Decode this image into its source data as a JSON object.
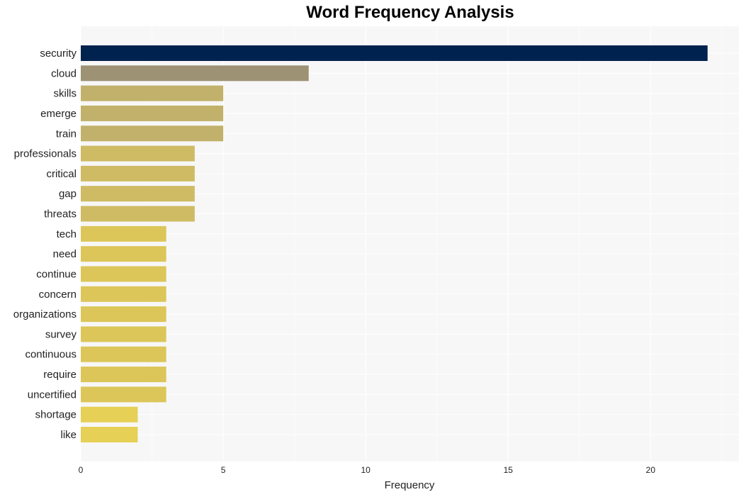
{
  "chart_data": {
    "type": "bar",
    "orientation": "horizontal",
    "title": "Word Frequency Analysis",
    "xlabel": "Frequency",
    "ylabel": "",
    "xlim": [
      0,
      23.1
    ],
    "xticks": [
      0,
      5,
      10,
      15,
      20
    ],
    "grid": true,
    "categories": [
      "security",
      "cloud",
      "skills",
      "emerge",
      "train",
      "professionals",
      "critical",
      "gap",
      "threats",
      "tech",
      "need",
      "continue",
      "concern",
      "organizations",
      "survey",
      "continuous",
      "require",
      "uncertified",
      "shortage",
      "like"
    ],
    "values": [
      22,
      8,
      5,
      5,
      5,
      4,
      4,
      4,
      4,
      3,
      3,
      3,
      3,
      3,
      3,
      3,
      3,
      3,
      2,
      2
    ],
    "colors": [
      "#00224e",
      "#9e9275",
      "#c1b16a",
      "#c1b16a",
      "#c1b16a",
      "#cfbb63",
      "#cfbb63",
      "#cfbb63",
      "#cfbb63",
      "#dcc65a",
      "#dcc65a",
      "#dcc65a",
      "#dcc65a",
      "#dcc65a",
      "#dcc65a",
      "#dcc65a",
      "#dcc65a",
      "#dcc65a",
      "#e6d055",
      "#e6d055"
    ]
  }
}
